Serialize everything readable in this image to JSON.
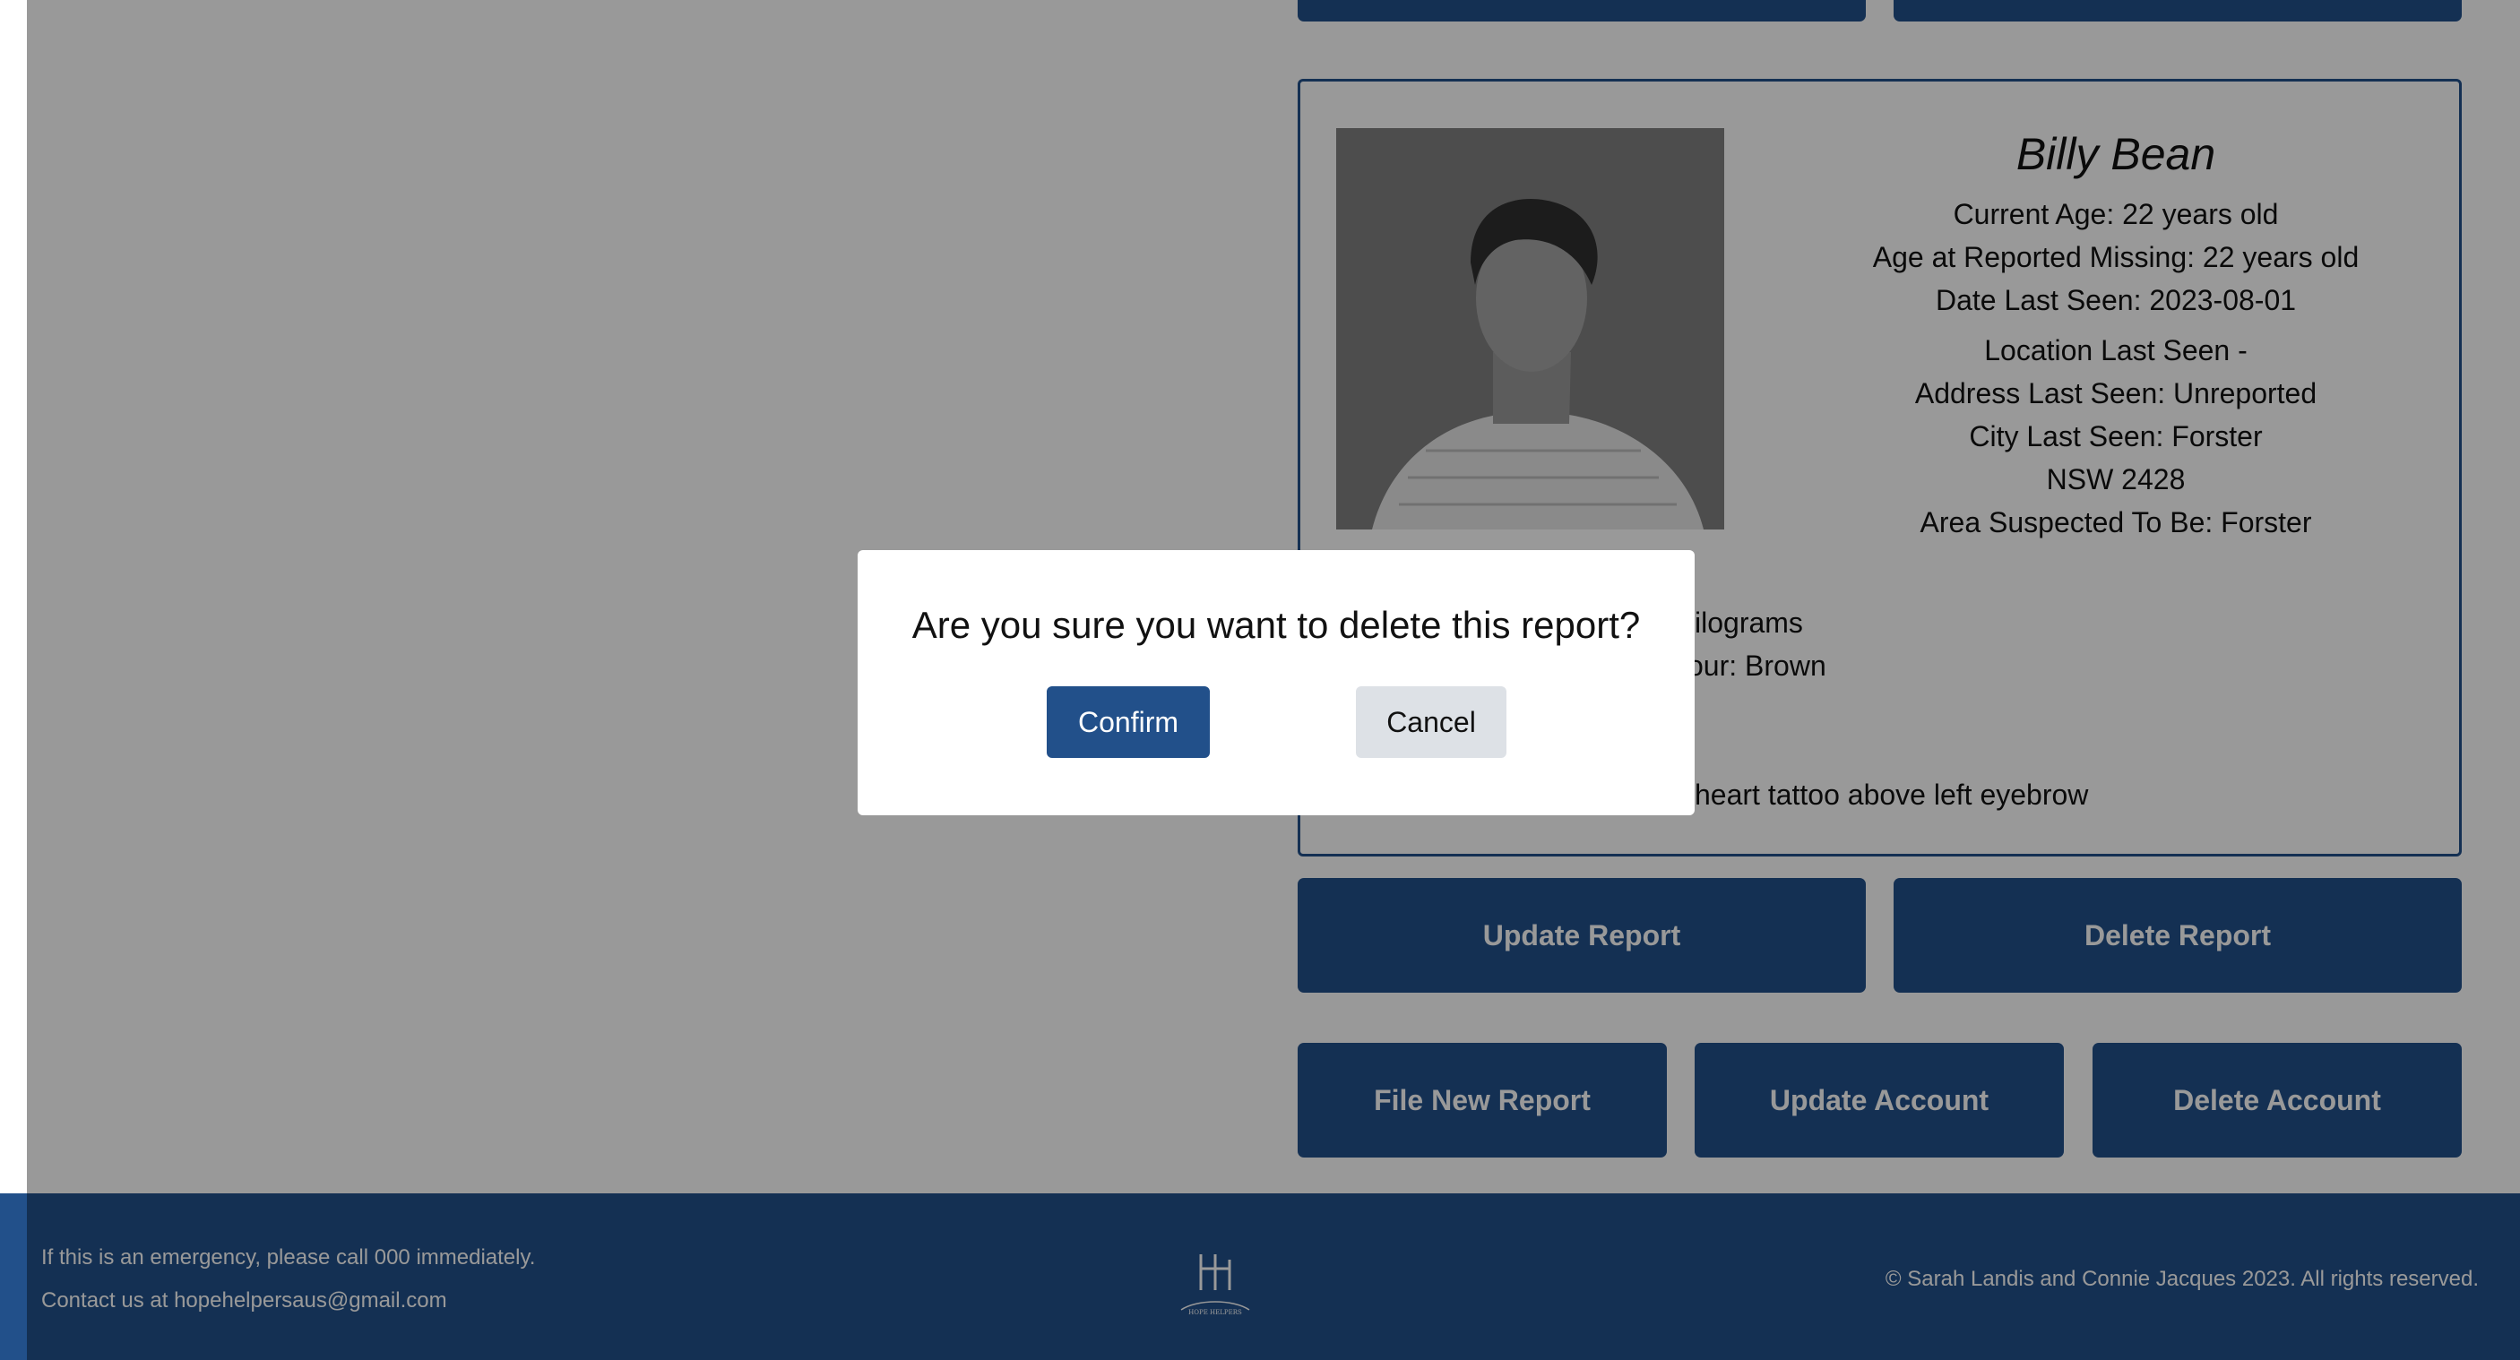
{
  "report": {
    "name": "Billy Bean",
    "current_age": "Current Age: 22 years old",
    "age_missing": "Age at Reported Missing: 22 years old",
    "date_last_seen": "Date Last Seen: 2023-08-01",
    "location_heading": "Location Last Seen -",
    "address": "Address Last Seen: Unreported",
    "city": "City Last Seen: Forster",
    "state_postcode": "NSW 2428",
    "area": "Area Suspected To Be: Forster",
    "weight_partial": "kilograms",
    "colour_partial": "our: Brown",
    "marks_partial": "heart tattoo above left eyebrow"
  },
  "actions": {
    "update_report": "Update Report",
    "delete_report": "Delete Report",
    "file_new_report": "File New Report",
    "update_account": "Update Account",
    "delete_account": "Delete Account"
  },
  "modal": {
    "question": "Are you sure you want to delete this report?",
    "confirm": "Confirm",
    "cancel": "Cancel"
  },
  "footer": {
    "emergency": "If this is an emergency, please call 000 immediately.",
    "contact": "Contact us at hopehelpersaus@gmail.com",
    "copyright": "© Sarah Landis and Connie Jacques 2023. All rights reserved.",
    "logo_text": "HOPE HELPERS"
  },
  "colors": {
    "brand": "#22508a",
    "cancel_bg": "#dde1e6",
    "overlay": "rgba(0,0,0,0.4)"
  }
}
